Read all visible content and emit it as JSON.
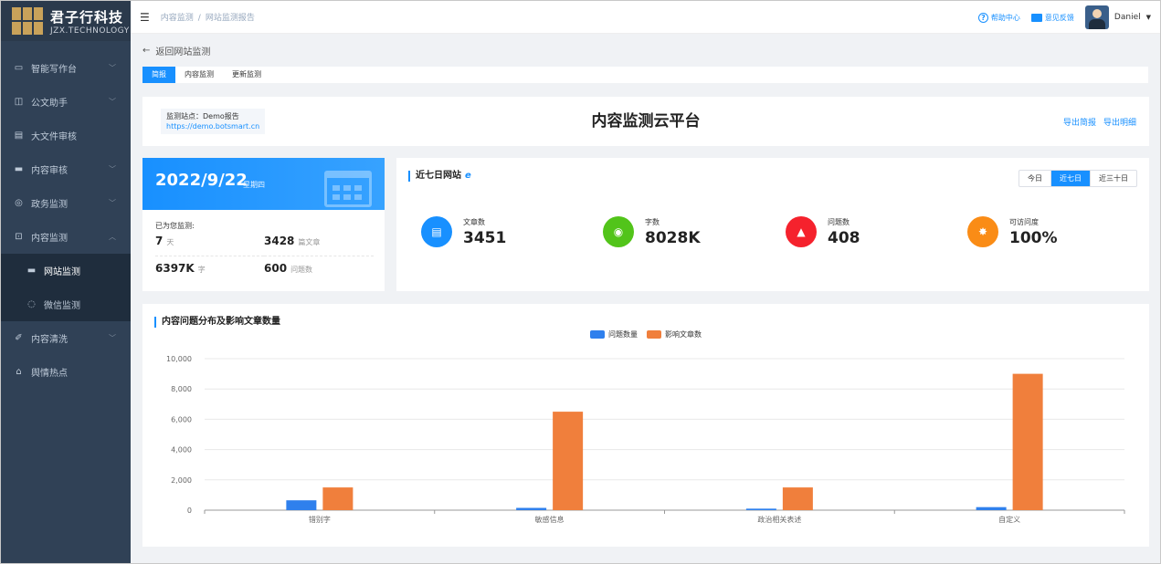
{
  "app": {
    "brand": "君子行科技",
    "brand_sub": "JZX.TECHNOLOGY"
  },
  "sidebar": {
    "items": [
      {
        "label": "智能写作台",
        "icon": "monitor-icon"
      },
      {
        "label": "公文助手",
        "icon": "document-icon"
      },
      {
        "label": "大文件审核",
        "icon": "file-icon"
      },
      {
        "label": "内容审核",
        "icon": "screen-icon"
      },
      {
        "label": "政务监测",
        "icon": "globe-icon"
      },
      {
        "label": "内容监测",
        "icon": "monitor-check-icon"
      },
      {
        "label": "内容清洗",
        "icon": "clean-icon"
      },
      {
        "label": "舆情热点",
        "icon": "bank-icon"
      }
    ],
    "submenu": [
      {
        "label": "网站监测"
      },
      {
        "label": "微信监测"
      }
    ]
  },
  "topbar": {
    "breadcrumb": [
      "内容监测",
      "网站监测报告"
    ],
    "help": "帮助中心",
    "feedback": "意见反馈",
    "user": "Daniel"
  },
  "main": {
    "back": "返回网站监测",
    "tabs": [
      "简报",
      "内容监测",
      "更新监测"
    ],
    "site_label": "监测站点：Demo报告",
    "site_url": "https://demo.botsmart.cn",
    "platform_title": "内容监测云平台",
    "export_brief": "导出简报",
    "export_detail": "导出明细"
  },
  "date_card": {
    "date": "2022/9/22",
    "weekday": "星期四",
    "monitored_label": "已为您监测:",
    "stats": [
      {
        "value": "7",
        "unit": "天"
      },
      {
        "value": "3428",
        "unit": "篇文章"
      },
      {
        "value": "6397K",
        "unit": "字"
      },
      {
        "value": "600",
        "unit": "问题数"
      }
    ]
  },
  "week_card": {
    "title": "近七日网站",
    "ranges": [
      "今日",
      "近七日",
      "近三十日"
    ],
    "active_range": "近七日",
    "metrics": [
      {
        "label": "文章数",
        "value": "3451",
        "color": "#1890ff",
        "icon": "article-icon"
      },
      {
        "label": "字数",
        "value": "8028K",
        "color": "#52c41a",
        "icon": "eye-icon"
      },
      {
        "label": "问题数",
        "value": "408",
        "color": "#f5222d",
        "icon": "alarm-icon"
      },
      {
        "label": "可访问度",
        "value": "100%",
        "color": "#fa8c16",
        "icon": "burst-icon"
      }
    ]
  },
  "chart_data": {
    "type": "bar",
    "title": "内容问题分布及影响文章数量",
    "categories": [
      "错别字",
      "敏感信息",
      "政治相关表述",
      "自定义"
    ],
    "series": [
      {
        "name": "问题数量",
        "color": "#2f80ed",
        "values": [
          650,
          150,
          100,
          200
        ]
      },
      {
        "name": "影响文章数",
        "color": "#f07f3c",
        "values": [
          1500,
          6500,
          1500,
          9000
        ]
      }
    ],
    "yticks": [
      "0",
      "2,000",
      "4,000",
      "6,000",
      "8,000",
      "10,000"
    ],
    "ylim": [
      0,
      10000
    ],
    "grid": true,
    "legend": "top-center"
  }
}
